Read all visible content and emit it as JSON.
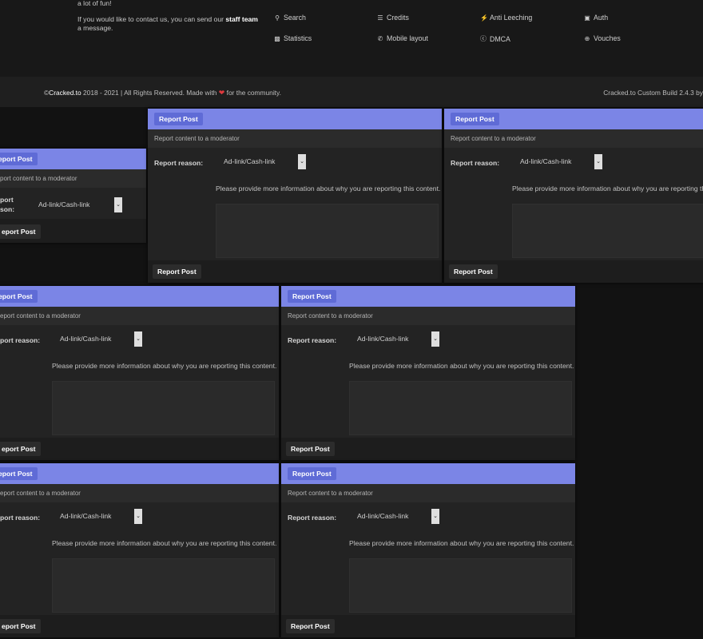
{
  "footer": {
    "about_line1": "can also learn many things here, meet new friends and have a lot of fun!",
    "about_line2_pre": "If you would like to contact us, you can send our",
    "about_line2_link": "staff team",
    "about_line2_post": "a message.",
    "links": [
      {
        "label": "Search",
        "icon": "search-icon"
      },
      {
        "label": "Credits",
        "icon": "credits-icon"
      },
      {
        "label": "Anti Leeching",
        "icon": "bolt-icon"
      },
      {
        "label": "Auth",
        "icon": "lock-icon"
      },
      {
        "label": "Statistics",
        "icon": "chart-icon"
      },
      {
        "label": "Mobile layout",
        "icon": "phone-icon"
      },
      {
        "label": "DMCA",
        "icon": "copyright-icon"
      },
      {
        "label": "Vouches",
        "icon": "plus-circle-icon"
      }
    ]
  },
  "copyright": {
    "prefix": "©",
    "brand": "Cracked.to",
    "text": " 2018 - 2021 | All Rights Reserved. Made with ",
    "suffix": " for the community.",
    "right": "Cracked.to Custom Build 2.4.3 by"
  },
  "modal": {
    "title": "Report Post",
    "subtitle": "Report content to a moderator",
    "reason_label": "Report reason:",
    "reason_value": "Ad-link/Cash-link",
    "description": "Please provide more information about why you are reporting this content.",
    "submit_label": "Report Post"
  },
  "modal_small": {
    "title_partial": "eport Post",
    "subtitle_partial": "port content to a moderator",
    "reason_partial_1": "port",
    "reason_partial_2": "son:",
    "submit_partial": "eport Post"
  },
  "modal_left": {
    "title_partial": "eport Post",
    "subtitle_partial": "eport content to a moderator",
    "reason_partial": "port reason:",
    "submit_partial": "eport Post"
  },
  "colors": {
    "header": "#7b85e6",
    "title_chip": "#5f6bd6",
    "body": "#232323",
    "background": "#121212"
  }
}
